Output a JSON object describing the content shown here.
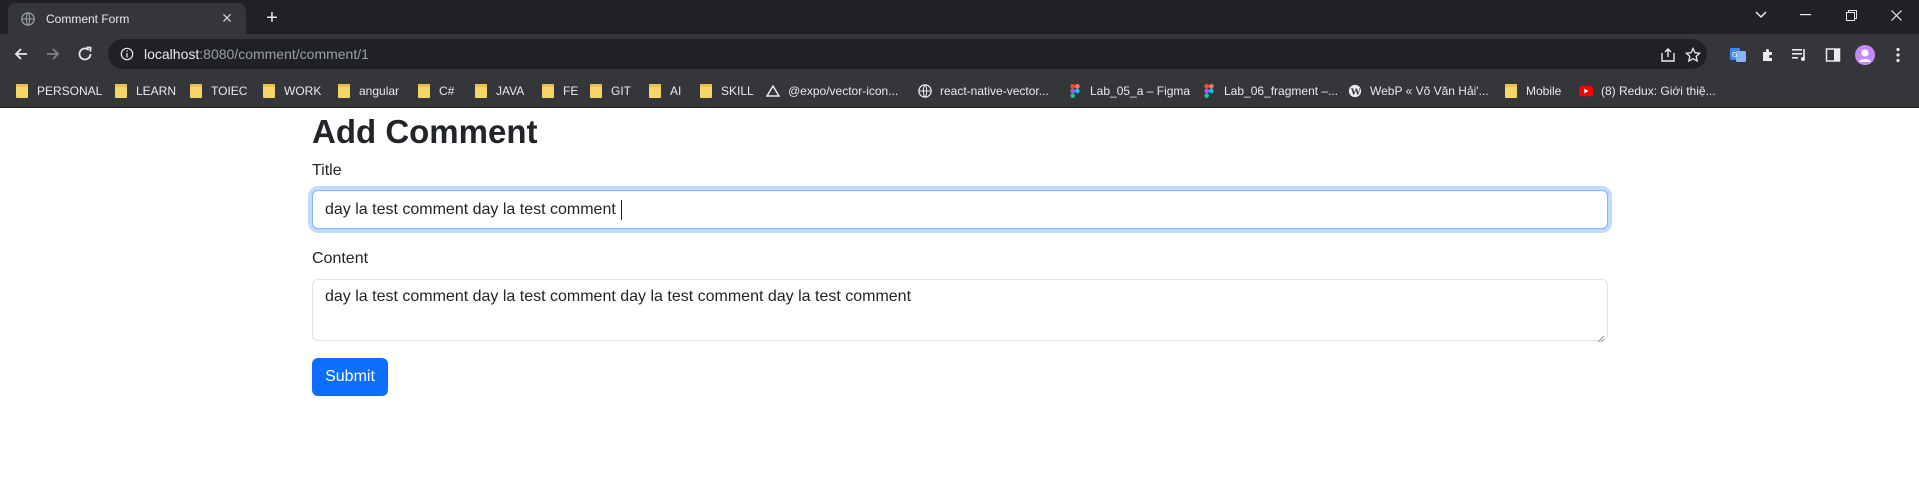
{
  "browser": {
    "tab": {
      "title": "Comment Form",
      "favicon": "globe-icon",
      "close": "✕"
    },
    "new_tab": "+",
    "address": {
      "host": "localhost",
      "rest": ":8080/comment/comment/1"
    },
    "bookmarks": [
      {
        "label": "PERSONAL",
        "icon": "folder-icon"
      },
      {
        "label": "LEARN",
        "icon": "folder-icon"
      },
      {
        "label": "TOIEC",
        "icon": "folder-icon"
      },
      {
        "label": "WORK",
        "icon": "folder-icon"
      },
      {
        "label": "angular",
        "icon": "folder-icon"
      },
      {
        "label": "C#",
        "icon": "folder-icon"
      },
      {
        "label": "JAVA",
        "icon": "folder-icon"
      },
      {
        "label": "FE",
        "icon": "folder-icon"
      },
      {
        "label": "GIT",
        "icon": "folder-icon"
      },
      {
        "label": "AI",
        "icon": "folder-icon"
      },
      {
        "label": "SKILL",
        "icon": "folder-icon"
      },
      {
        "label": "@expo/vector-icon...",
        "icon": "expo-icon"
      },
      {
        "label": "react-native-vector...",
        "icon": "globe-icon"
      },
      {
        "label": "Lab_05_a – Figma",
        "icon": "figma-icon"
      },
      {
        "label": "Lab_06_fragment –...",
        "icon": "figma-icon"
      },
      {
        "label": "WebP « Võ Văn Hải'...",
        "icon": "wordpress-icon"
      },
      {
        "label": "Mobile",
        "icon": "folder-icon"
      },
      {
        "label": "(8) Redux: Giới thiệ...",
        "icon": "youtube-icon"
      }
    ]
  },
  "page": {
    "heading": "Add Comment",
    "title_label": "Title",
    "title_value": "day la test comment day la test comment",
    "content_label": "Content",
    "content_value": "day la test comment day la test comment day la test comment day la test comment",
    "submit_label": "Submit"
  },
  "colors": {
    "chrome_dark": "#202124",
    "chrome_toolbar": "#35363a",
    "primary": "#0d6efd",
    "text": "#212529"
  }
}
